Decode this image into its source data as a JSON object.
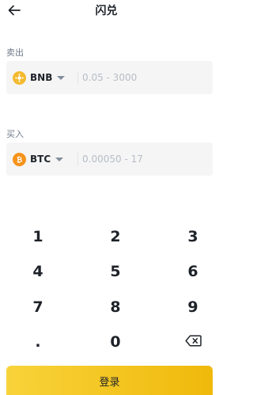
{
  "header": {
    "title": "闪兑"
  },
  "from": {
    "label": "卖出",
    "coin": "BNB",
    "placeholder": "0.05 - 3000",
    "icon": "bnb-coin-icon",
    "icon_color": "#f3ba2f"
  },
  "to": {
    "label": "买入",
    "coin": "BTC",
    "placeholder": "0.00050 - 17",
    "icon": "btc-coin-icon",
    "icon_color": "#f7931a"
  },
  "keypad": {
    "keys": [
      "1",
      "2",
      "3",
      "4",
      "5",
      "6",
      "7",
      "8",
      "9",
      ".",
      "0",
      "backspace-icon"
    ]
  },
  "submit": {
    "label": "登录"
  },
  "colors": {
    "accent": "#f0b90b",
    "text": "#1e2329",
    "muted": "#707a8a",
    "field_bg": "#f5f5f5"
  }
}
